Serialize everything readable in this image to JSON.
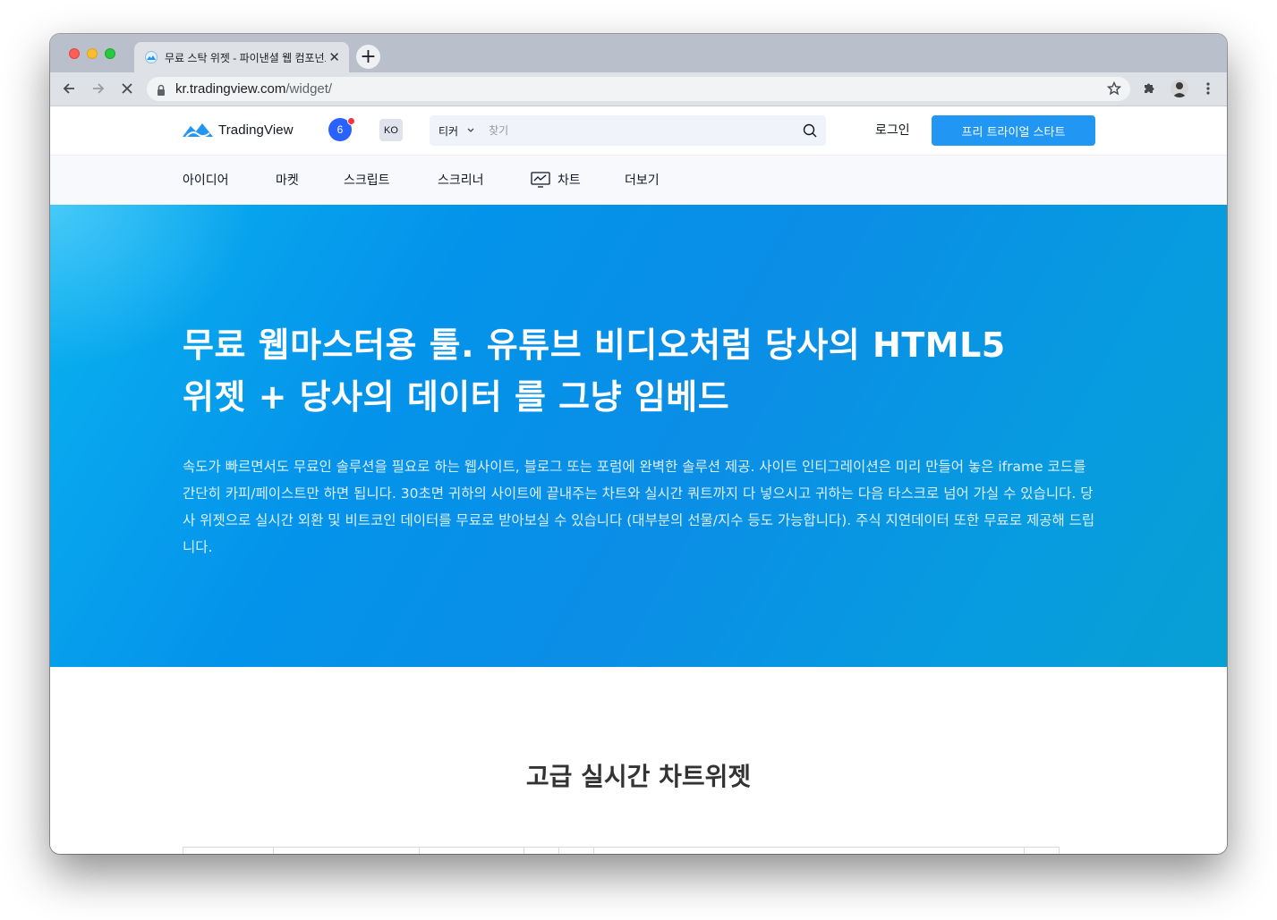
{
  "browser": {
    "tab_title": "무료 스탁 위젯 - 파이낸셜 웹 컴포넌트",
    "tab_close": "✕",
    "new_tab": "+",
    "url_host": "kr.tradingview.com",
    "url_path": "/widget/"
  },
  "header": {
    "logo_text": "TradingView",
    "notification_count": "6",
    "language": "KO",
    "search_scope": "티커",
    "search_placeholder": "찾기",
    "login_label": "로그인",
    "trial_label": "프리 트라이얼 스타트"
  },
  "nav": {
    "items": [
      "아이디어",
      "마켓",
      "스크립트",
      "스크리너",
      "차트",
      "더보기"
    ]
  },
  "hero": {
    "title_line1": "무료 웹마스터용 툴. 유튜브 비디오처럼 당사의 HTML5",
    "title_line2": "위젯 + 당사의 데이터 를 그냥 임베드",
    "description": "속도가 빠르면서도 무료인 솔루션을 필요로 하는 웹사이트, 블로그 또는 포럼에 완벽한 솔루션 제공. 사이트 인티그레이션은 미리 만들어 놓은 iframe 코드를 간단히 카피/페이스트만 하면 됩니다. 30초면 귀하의 사이트에 끝내주는 차트와 실시간 쿼트까지 다 넣으시고 귀하는 다음 타스크로 넘어 가실 수 있습니다. 당사 위젯으로 실시간 외환 및 비트코인 데이터를 무료로 받아보실 수 있습니다 (대부분의 선물/지수 등도 가능합니다). 주식 지연데이터 또한 무료로 제공해 드립니다."
  },
  "section": {
    "title": "고급 실시간 차트위젯"
  },
  "colors": {
    "accent": "#2196f3",
    "hero_gradient_start": "#0ab2f0",
    "hero_gradient_end": "#07a0d4",
    "notification_dot": "#f23645"
  }
}
